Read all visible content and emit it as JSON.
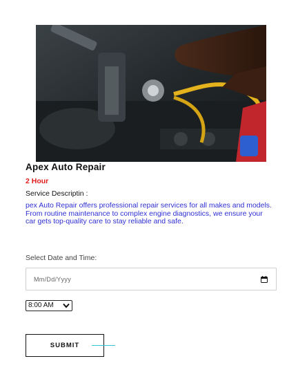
{
  "service": {
    "title": "Apex Auto Repair",
    "duration": "2 Hour",
    "description_label": "Service Descriptin :",
    "description": "pex Auto Repair offers professional repair services for all makes and models. From routine maintenance to complex engine diagnostics, we ensure your car gets top-quality care to stay reliable and safe."
  },
  "booking": {
    "date_label": "Select Date and Time:",
    "date_placeholder": "Mm/Dd/Yyyy",
    "time_selected": "8:00 AM",
    "submit_label": "SUBMIT"
  },
  "colors": {
    "duration": "#e01b1b",
    "description": "#2f2fd6",
    "cursor_accent": "#31c4d4"
  },
  "icons": {
    "calendar": "calendar-icon",
    "dropdown": "chevron-down-icon"
  }
}
